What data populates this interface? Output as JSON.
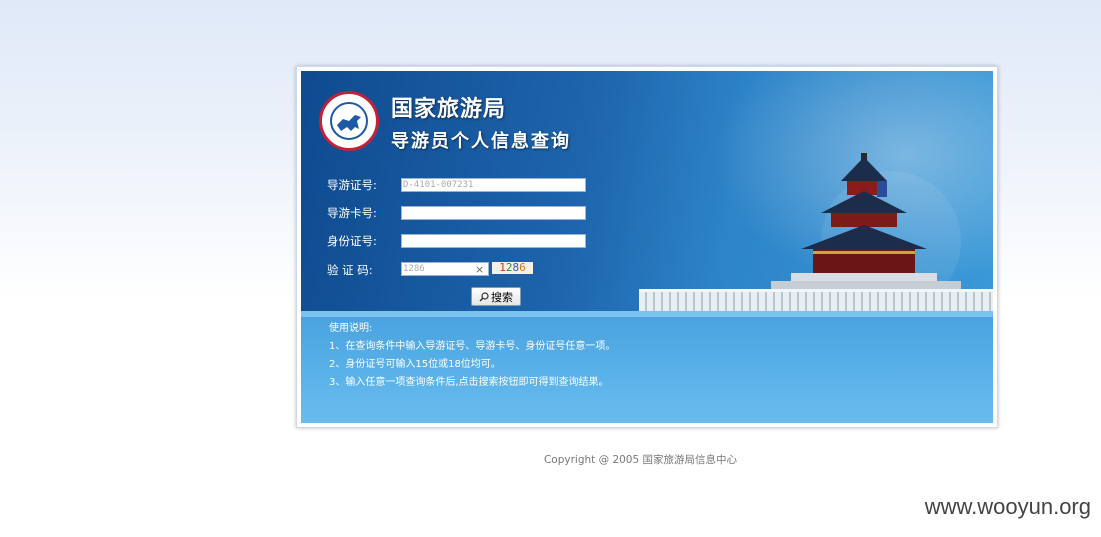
{
  "header": {
    "agency": "国家旅游局",
    "subtitle": "导游员个人信息查询"
  },
  "form": {
    "guide_cert_label": "导游证号:",
    "guide_cert_value": "D-4101-007231",
    "guide_card_label": "导游卡号:",
    "guide_card_value": "",
    "id_card_label": "身份证号:",
    "id_card_value": "",
    "captcha_label": "验 证 码:",
    "captcha_value": "1286",
    "captcha_clear": "×",
    "captcha_image_text": [
      "1",
      "2",
      "8",
      "6"
    ],
    "search_button": "搜索"
  },
  "help": {
    "title": "使用说明:",
    "lines": [
      "1、在查询条件中输入导游证号、导游卡号、身份证号任意一项。",
      "2、身份证号可输入15位或18位均可。",
      "3、输入任意一项查询条件后,点击搜索按钮即可得到查询结果。"
    ]
  },
  "footer": {
    "copyright": "Copyright @ 2005 国家旅游局信息中心"
  },
  "watermark": "www.wooyun.org",
  "colors": {
    "panel_dark": "#0f4a8f",
    "panel_light": "#3b9ad8",
    "logo_ring": "#c4203a"
  },
  "icons": {
    "logo": "horse-emblem-icon",
    "search": "magnifier-icon"
  }
}
